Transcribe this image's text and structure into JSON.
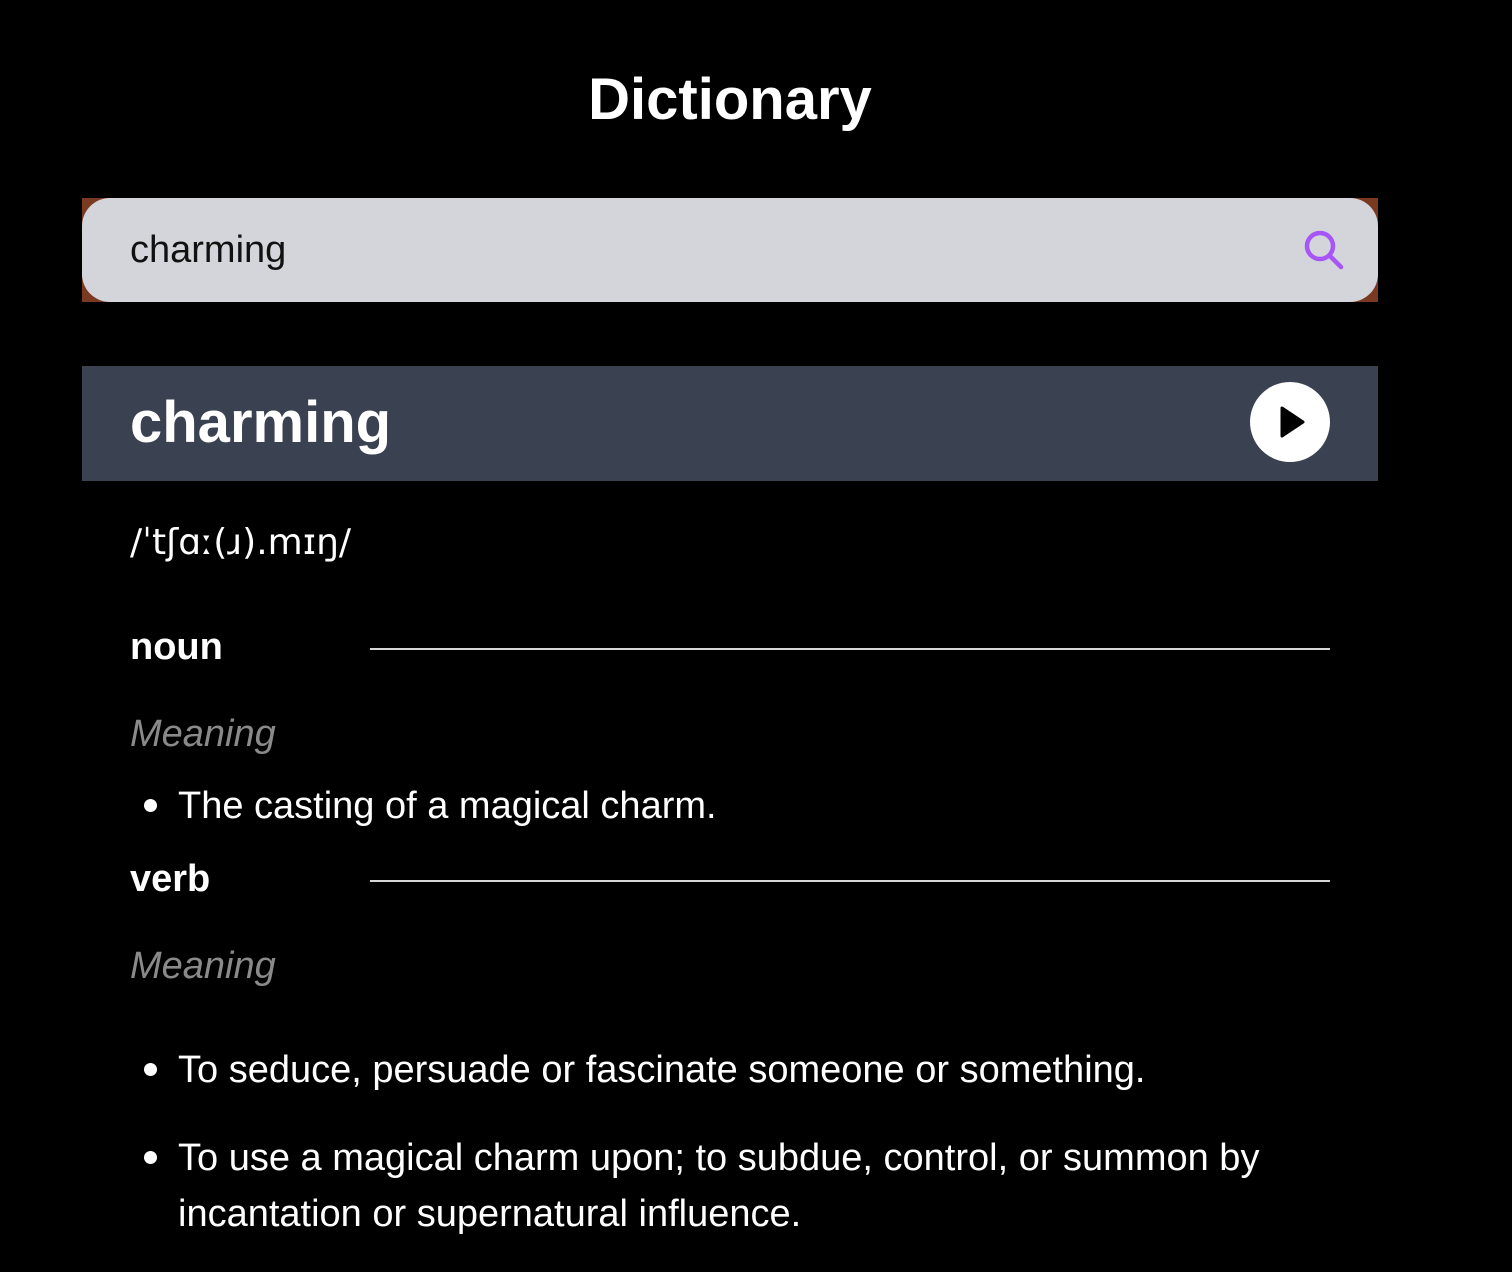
{
  "page": {
    "title": "Dictionary"
  },
  "search": {
    "value": "charming",
    "placeholder": "",
    "icon": "search-icon",
    "accent_color": "#a855f7"
  },
  "entry": {
    "word": "charming",
    "phonetic": "/ˈtʃɑː(ɹ).mɪŋ/",
    "play_icon": "play-icon",
    "header_color": "#3a4150",
    "meanings": [
      {
        "part_of_speech": "noun",
        "meaning_label": "Meaning",
        "definitions": [
          "The casting of a magical charm."
        ]
      },
      {
        "part_of_speech": "verb",
        "meaning_label": "Meaning",
        "definitions": [
          "To seduce, persuade or fascinate someone or something.",
          "To use a magical charm upon; to subdue, control, or summon by incantation or supernatural influence."
        ]
      }
    ]
  }
}
